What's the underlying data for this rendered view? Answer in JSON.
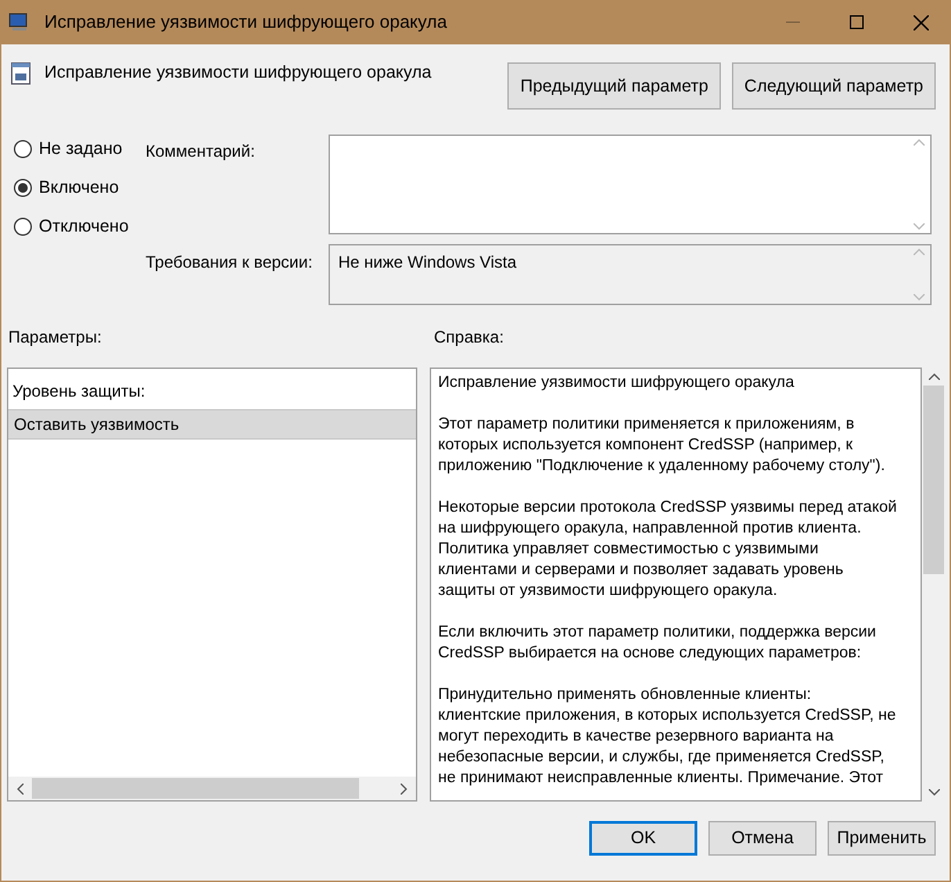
{
  "window": {
    "title": "Исправление уязвимости шифрующего оракула"
  },
  "header": {
    "title": "Исправление уязвимости шифрующего оракула"
  },
  "nav_buttons": [
    "Предыдущий параметр",
    "Следующий параметр"
  ],
  "state_options": [
    {
      "label": "Не задано",
      "selected": false
    },
    {
      "label": "Включено",
      "selected": true
    },
    {
      "label": "Отключено",
      "selected": false
    }
  ],
  "comment": {
    "label": "Комментарий:"
  },
  "version": {
    "label": "Требования к версии:",
    "value": "Не ниже Windows Vista"
  },
  "options": {
    "label": "Параметры:",
    "field_label": "Уровень защиты:",
    "items": [
      {
        "text": "Оставить уязвимость",
        "selected": true
      }
    ]
  },
  "help": {
    "label": "Справка:",
    "paragraphs": [
      [
        "Исправление уязвимости шифрующего оракула"
      ],
      [
        "Этот параметр политики применяется к приложениям, в",
        "которых используется компонент CredSSP (например, к",
        "приложению \"Подключение к удаленному рабочему столу\")."
      ],
      [
        "Некоторые версии протокола CredSSP уязвимы перед атакой",
        "на шифрующего оракула, направленной против клиента.",
        "Политика управляет совместимостью с уязвимыми",
        "клиентами и серверами и позволяет задавать уровень",
        "защиты от уязвимости шифрующего оракула."
      ],
      [
        "Если включить этот параметр политики, поддержка версии",
        "CredSSP выбирается на основе следующих параметров:"
      ],
      [
        "Принудительно применять обновленные клиенты:",
        "клиентские приложения, в которых используется CredSSP, не",
        "могут переходить в качестве резервного варианта на",
        "небезопасные версии, и службы, где применяется CredSSP,",
        "не принимают неисправленные клиенты. Примечание. Этот"
      ]
    ]
  },
  "buttons": [
    {
      "label": "OK",
      "kind": "default"
    },
    {
      "label": "Отмена",
      "kind": "normal"
    },
    {
      "label": "Применить",
      "kind": "normal"
    }
  ]
}
